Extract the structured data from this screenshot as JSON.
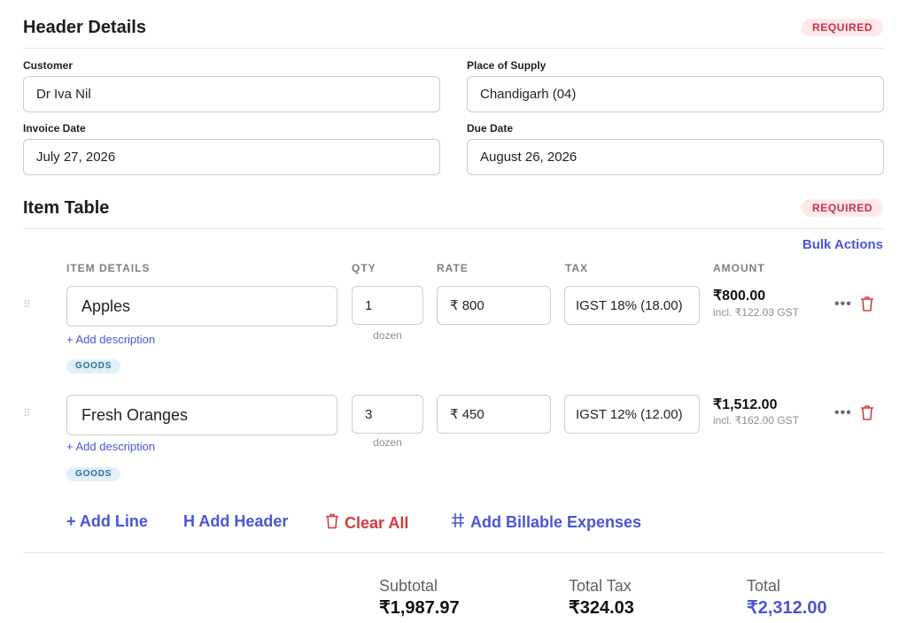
{
  "header_section": {
    "title": "Header Details",
    "badge": "REQUIRED",
    "customer_label": "Customer",
    "customer_value": "Dr Iva Nil",
    "place_label": "Place of Supply",
    "place_value": "Chandigarh (04)",
    "invoice_date_label": "Invoice Date",
    "invoice_date_value": "July 27, 2026",
    "due_date_label": "Due Date",
    "due_date_value": "August 26, 2026"
  },
  "item_section": {
    "title": "Item Table",
    "badge": "REQUIRED",
    "bulk_actions": "Bulk Actions",
    "columns": [
      "ITEM DETAILS",
      "QTY",
      "RATE",
      "TAX",
      "AMOUNT"
    ],
    "items": [
      {
        "name": "Apples",
        "add_description": "+ Add description",
        "type_badge": "GOODS",
        "qty": "1",
        "unit": "dozen",
        "rate": "₹ 800",
        "tax": "IGST 18% (18.00)",
        "amount": "₹800.00",
        "amount_sub": "incl. ₹122.03 GST",
        "more": "•••"
      },
      {
        "name": "Fresh Oranges",
        "add_description": "+ Add description",
        "type_badge": "GOODS",
        "qty": "3",
        "unit": "dozen",
        "rate": "₹ 450",
        "tax": "IGST 12% (12.00)",
        "amount": "₹1,512.00",
        "amount_sub": "incl. ₹162.00 GST",
        "more": "•••"
      }
    ],
    "actions": {
      "add_line": "+ Add Line",
      "add_header": "H Add Header",
      "clear_all": "Clear All",
      "add_billable": "Add Billable Expenses"
    }
  },
  "totals": {
    "subtotal_label": "Subtotal",
    "subtotal_value": "₹1,987.97",
    "tax_label": "Total Tax",
    "tax_value": "₹324.03",
    "total_label": "Total",
    "total_value": "₹2,312.00"
  },
  "colors": {
    "accent": "#4a55d6",
    "danger": "#d23c3c",
    "badge_required_bg": "#fde8ea",
    "goods_badge_bg": "#dff0fb"
  },
  "icons": [
    "drag-handle-icon",
    "more-options-icon",
    "trash-icon",
    "hash-icon"
  ]
}
